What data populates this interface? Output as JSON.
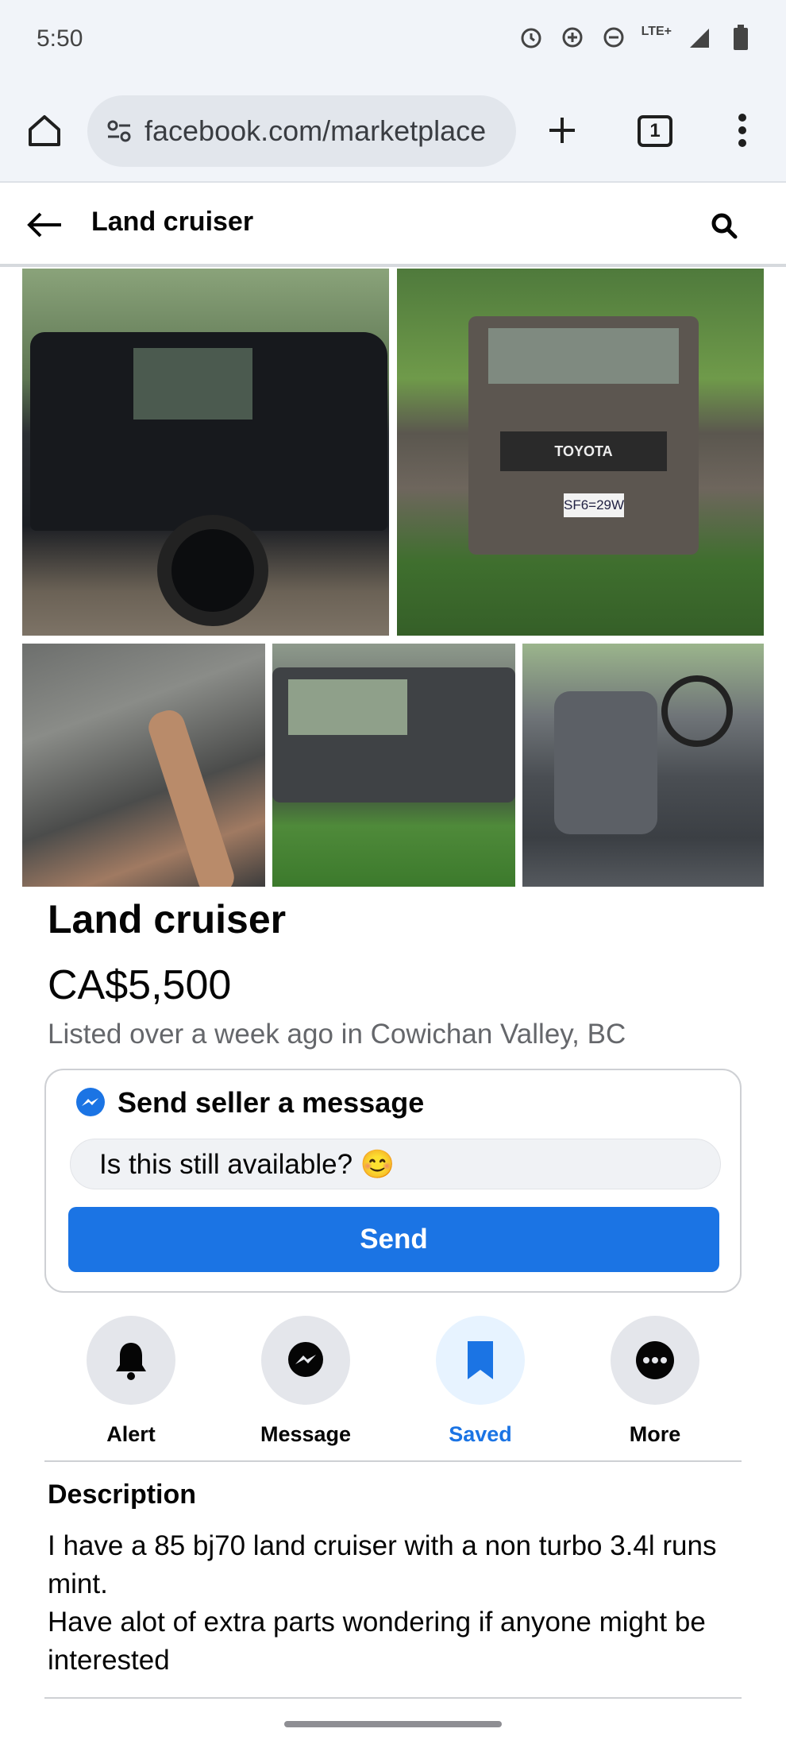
{
  "status_bar": {
    "time": "5:50",
    "network": "LTE+"
  },
  "browser": {
    "url": "facebook.com/marketplace",
    "tab_count": "1"
  },
  "header": {
    "title": "Land cruiser"
  },
  "photos": [
    {
      "alt": "Black Land Cruiser rear side view"
    },
    {
      "alt": "Land Cruiser front view with TOYOTA grille and plate SF6=29W"
    },
    {
      "alt": "Engine bay"
    },
    {
      "alt": "Side view in vegetation"
    },
    {
      "alt": "Interior seats and steering wheel"
    }
  ],
  "photo_text": {
    "grille": "TOYOTA",
    "plate": "SF6=29W"
  },
  "listing": {
    "title": "Land cruiser",
    "price": "CA$5,500",
    "meta": "Listed over a week ago in Cowichan Valley, BC"
  },
  "message": {
    "heading": "Send seller a message",
    "input_value": "Is this still available? 😊",
    "send_label": "Send"
  },
  "actions": [
    {
      "label": "Alert",
      "icon": "bell-icon"
    },
    {
      "label": "Message",
      "icon": "messenger-icon"
    },
    {
      "label": "Saved",
      "icon": "bookmark-icon"
    },
    {
      "label": "More",
      "icon": "more-icon"
    }
  ],
  "description": {
    "heading": "Description",
    "body": "I have a 85 bj70 land cruiser with a non turbo 3.4l runs mint.\nHave alot of extra parts wondering if anyone might be interested"
  },
  "colors": {
    "accent": "#1b74e4",
    "saved_bg": "#e7f3ff",
    "chrome_bg": "#f1f4f9"
  }
}
